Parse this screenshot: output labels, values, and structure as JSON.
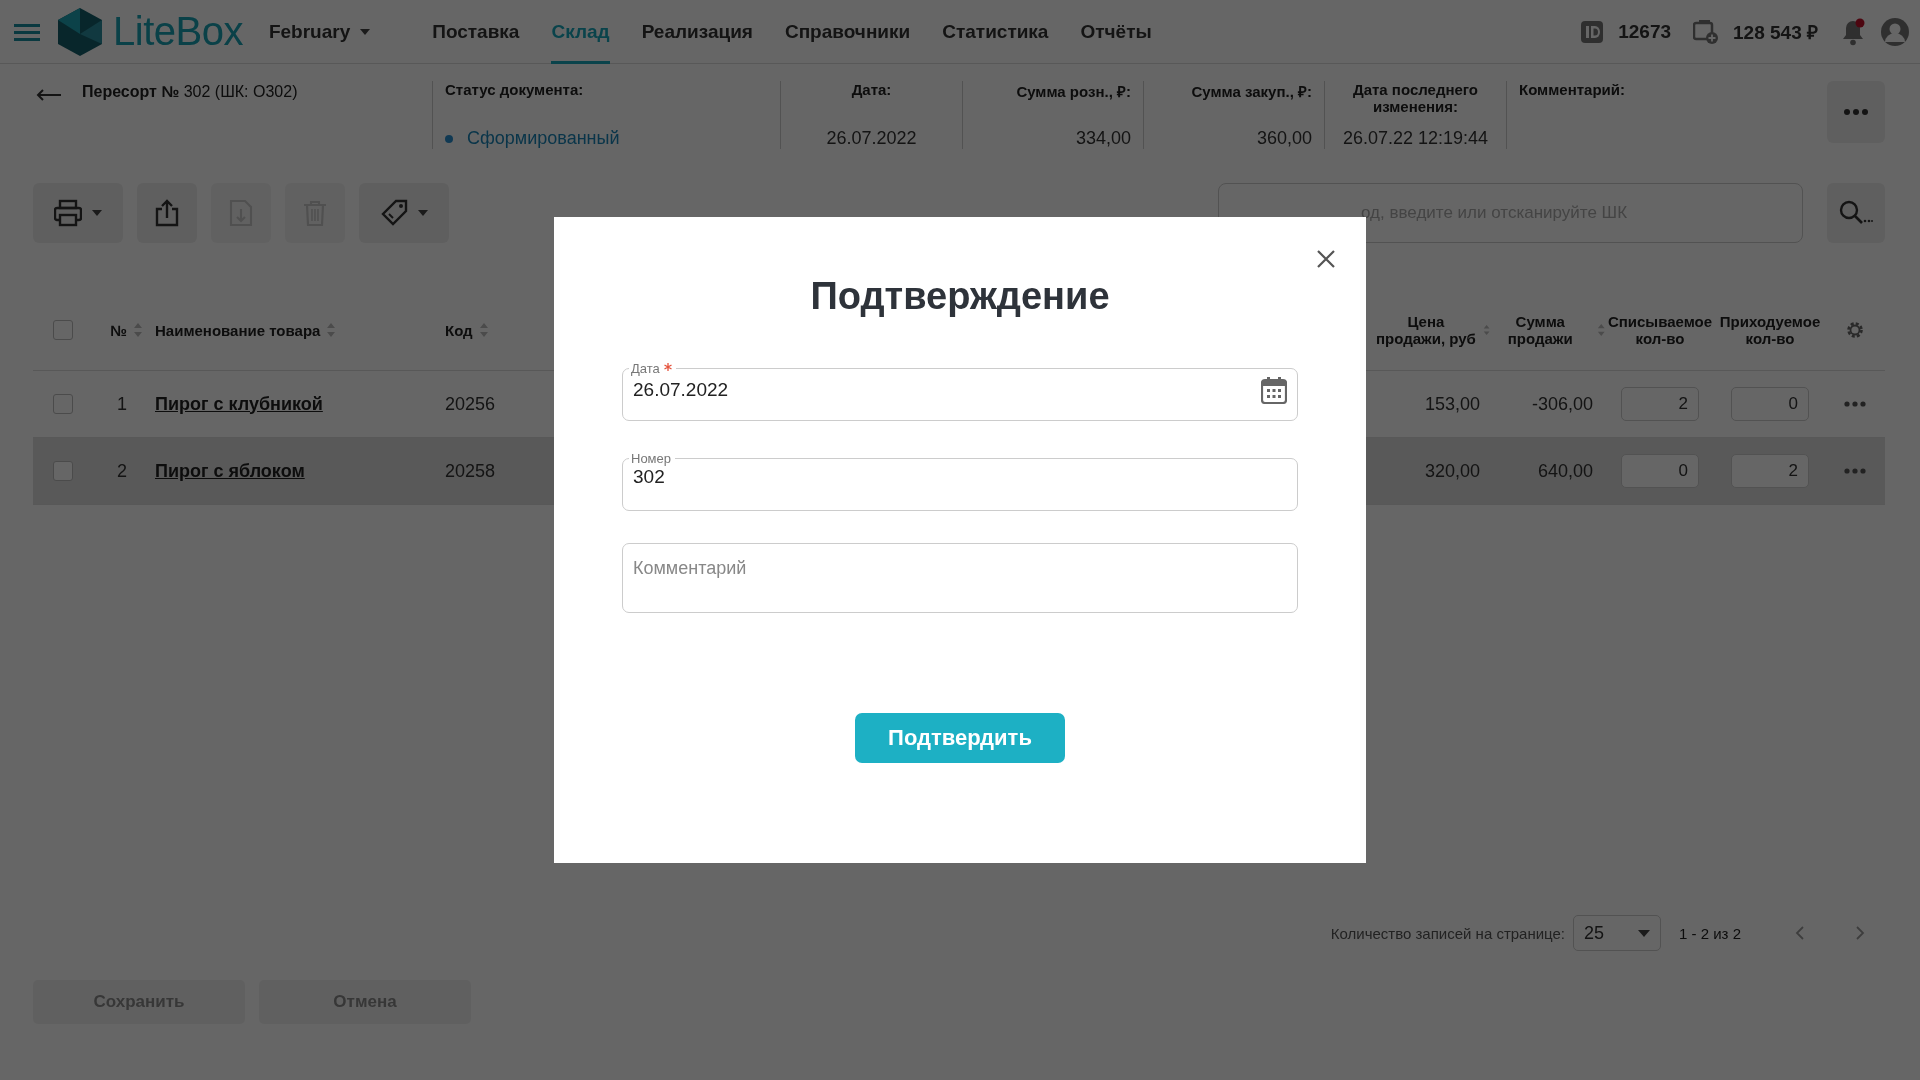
{
  "header": {
    "brand": "LiteBox",
    "company": "February",
    "nav": [
      {
        "label": "Поставка",
        "selected": false
      },
      {
        "label": "Склад",
        "selected": true
      },
      {
        "label": "Реализация",
        "selected": false
      },
      {
        "label": "Справочники",
        "selected": false
      },
      {
        "label": "Статистика",
        "selected": false
      },
      {
        "label": "Отчёты",
        "selected": false
      }
    ],
    "account_id": "12673",
    "balance": "128 543 ₽",
    "unread_notifications": true
  },
  "document": {
    "title": "**Пересорт №** 302 (ШК: О302)",
    "fields": [
      {
        "kind": "status",
        "label": "Статус документа:",
        "value": "Сформированный"
      },
      {
        "kind": "date",
        "label": "Дата:",
        "value": "26.07.2022"
      },
      {
        "kind": "amount",
        "label": "Сумма розн., ₽:",
        "value": "334,00"
      },
      {
        "kind": "amount",
        "label": "Сумма закуп., ₽:",
        "value": "360,00"
      },
      {
        "kind": "date",
        "label": "Дата последнего изменения:",
        "value": "26.07.22 12:19:44"
      },
      {
        "kind": "comment",
        "label": "Комментарий:"
      }
    ]
  },
  "toolbar": {
    "buttons": [
      {
        "kind": "print",
        "disabled": false,
        "dropdown": true
      },
      {
        "kind": "export",
        "disabled": false,
        "dropdown": false
      },
      {
        "kind": "import",
        "disabled": true,
        "dropdown": false
      },
      {
        "kind": "delete",
        "disabled": true,
        "dropdown": false
      },
      {
        "kind": "tag",
        "disabled": false,
        "dropdown": true
      }
    ],
    "search": {
      "placeholder": "од, введите или отсканируйте ШК"
    }
  },
  "table": {
    "columns": [
      {
        "kind": "check",
        "checked": false
      },
      {
        "kind": "sortable",
        "label": "№"
      },
      {
        "kind": "sortable",
        "label": "Наименование товара"
      },
      {
        "kind": "sortable",
        "label": "Код"
      },
      {
        "kind": "gap"
      },
      {
        "kind": "sortable",
        "label": "Цена продажи, руб"
      },
      {
        "kind": "sortable",
        "label": "Сумма продажи"
      },
      {
        "kind": "text",
        "label": "Списываемое кол-во"
      },
      {
        "kind": "text",
        "label": "Приходуемое кол-во"
      },
      {
        "kind": "settings"
      }
    ],
    "rows": [
      {
        "checked": false,
        "highlighted": false,
        "number": "1",
        "name": "Пирог с клубникой",
        "code": "20256",
        "price": "153,00",
        "sum": "-306,00",
        "write_off": "2",
        "incoming": "0"
      },
      {
        "checked": false,
        "highlighted": true,
        "number": "2",
        "name": "Пирог с яблоком",
        "code": "20258",
        "price": "320,00",
        "sum": "640,00",
        "write_off": "0",
        "incoming": "2"
      }
    ]
  },
  "pagination": {
    "label": "Количество записей на странице:",
    "page_size": "25",
    "range": "1 - 2 из 2"
  },
  "actions": [
    {
      "label": "Сохранить",
      "disabled": true
    },
    {
      "label": "Отмена",
      "disabled": true
    }
  ],
  "dialog": {
    "title": "Подтверждение",
    "fields": [
      {
        "kind": "date",
        "label": "Дата",
        "required": true,
        "value": "26.07.2022"
      },
      {
        "kind": "text",
        "label": "Номер",
        "required": false,
        "value": "302"
      },
      {
        "kind": "textarea",
        "placeholder": "Комментарий"
      }
    ],
    "confirm": "Подтвердить"
  }
}
